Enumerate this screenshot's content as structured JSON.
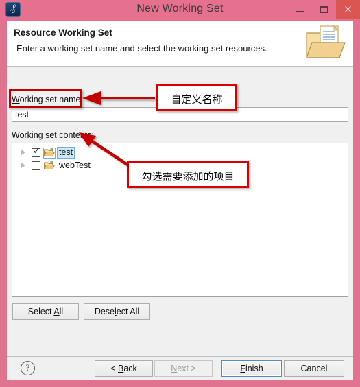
{
  "window": {
    "title": "New Working Set",
    "app_icon": "eclipse-icon",
    "minimize_label": "–",
    "maximize_label": "□",
    "close_label": "×",
    "frame_color": "#e5718e",
    "close_button_color": "#d9544f"
  },
  "header": {
    "title": "Resource Working Set",
    "description": "Enter a working set name and select the working set resources.",
    "icon": "folder-document-icon"
  },
  "form": {
    "name_label_pre": "W",
    "name_label_post": "orking set name:",
    "name_value": "test",
    "name_placeholder": "",
    "contents_label": "Working set contents:",
    "tree": [
      {
        "label": "test",
        "checked": true,
        "selected": true,
        "icon": "open-folder-icon",
        "expandable": true
      },
      {
        "label": "webTest",
        "checked": false,
        "selected": false,
        "icon": "open-folder-icon",
        "expandable": true
      }
    ],
    "select_all": {
      "pre": "Select ",
      "mn": "A",
      "post": "ll"
    },
    "deselect_all": {
      "pre": "Dese",
      "mn": "l",
      "post": "ect All"
    }
  },
  "footer": {
    "help_label": "?",
    "back": {
      "pre": "< ",
      "mn": "B",
      "post": "ack"
    },
    "next": {
      "pre": "",
      "mn": "N",
      "post": "ext >"
    },
    "finish": {
      "pre": "",
      "mn": "F",
      "post": "inish"
    },
    "cancel": {
      "pre": "Cancel",
      "mn": "",
      "post": ""
    },
    "next_disabled": true,
    "finish_default": true
  },
  "annotations": {
    "callout_name": "自定义名称",
    "callout_items": "勾选需要添加的项目",
    "color": "#d40000"
  }
}
